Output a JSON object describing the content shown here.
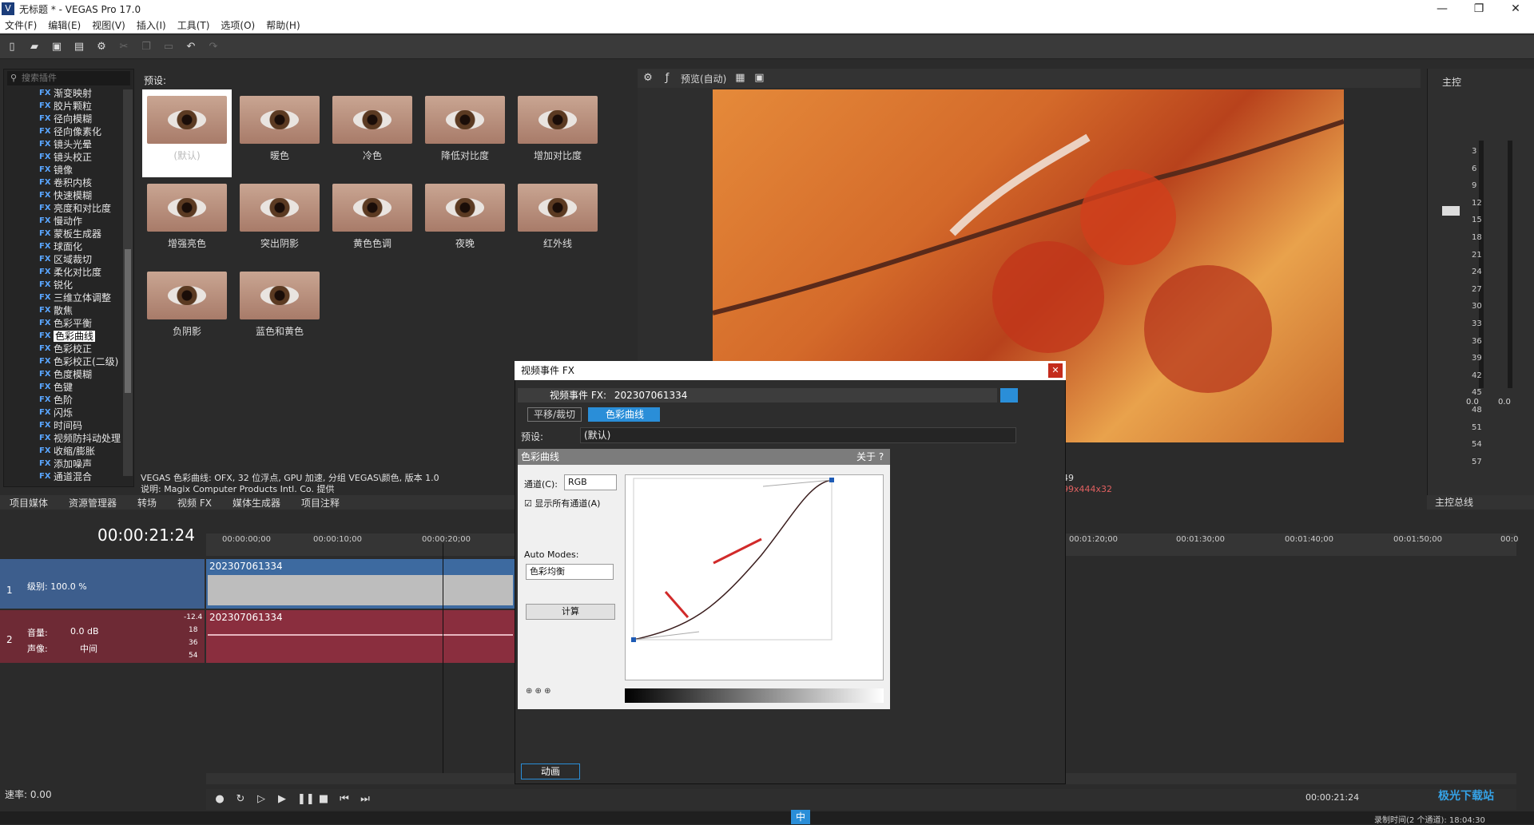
{
  "window": {
    "title": "无标题 * - VEGAS Pro 17.0",
    "minimize": "—",
    "maximize": "❐",
    "close": "✕"
  },
  "menu": [
    "文件(F)",
    "编辑(E)",
    "视图(V)",
    "插入(I)",
    "工具(T)",
    "选项(O)",
    "帮助(H)"
  ],
  "fx_panel": {
    "search_placeholder": "搜索插件",
    "items": [
      "渐变映射",
      "胶片颗粒",
      "径向模糊",
      "径向像素化",
      "镜头光晕",
      "镜头校正",
      "镜像",
      "卷积内核",
      "快速模糊",
      "亮度和对比度",
      "慢动作",
      "蒙板生成器",
      "球面化",
      "区域裁切",
      "柔化对比度",
      "锐化",
      "三维立体调整",
      "散焦",
      "色彩平衡",
      "色彩曲线",
      "色彩校正",
      "色彩校正(二级)",
      "色度模糊",
      "色键",
      "色阶",
      "闪烁",
      "时间码",
      "视频防抖动处理",
      "收缩/膨胀",
      "添加噪声",
      "通道混合"
    ],
    "selected": "色彩曲线",
    "fx_tag": "FX"
  },
  "presets": {
    "label": "预设:",
    "tiles": [
      "(默认)",
      "暖色",
      "冷色",
      "降低对比度",
      "增加对比度",
      "增强亮色",
      "突出阴影",
      "黄色色调",
      "夜晚",
      "红外线",
      "负阴影",
      "蓝色和黄色"
    ],
    "selected": "(默认)"
  },
  "fx_description": {
    "line1": "VEGAS 色彩曲线: OFX, 32 位浮点, GPU 加速, 分组 VEGAS\\颜色, 版本 1.0",
    "line2": "说明: Magix Computer Products Intl. Co. 提供"
  },
  "bottom_tabs": [
    "项目媒体",
    "资源管理器",
    "转场",
    "视频 FX",
    "媒体生成器",
    "项目注释"
  ],
  "preview": {
    "mode": "预览(自动)",
    "info_line1": "49",
    "info_line2": "99x444x32"
  },
  "mixer": {
    "label": "主控",
    "ticks": [
      "3",
      "6",
      "9",
      "12",
      "15",
      "18",
      "21",
      "24",
      "27",
      "30",
      "33",
      "36",
      "39",
      "42",
      "45",
      "48",
      "51",
      "54",
      "57"
    ],
    "bottom_values": [
      "0.0",
      "0.0"
    ],
    "tab": "主控总线"
  },
  "timeline": {
    "timecode": "00:00:21:24",
    "ruler": [
      "00:00:00;00",
      "00:00:10;00",
      "00:00:20;00",
      "00:01:20;00",
      "00:01:30;00",
      "00:01:40;00",
      "00:01:50;00",
      "00:0"
    ],
    "video_track": {
      "num": "1",
      "level": "级别: 100.0 %",
      "clip": "202307061334"
    },
    "audio_track": {
      "num": "2",
      "volume_lbl": "音量:",
      "volume": "0.0 dB",
      "pan_lbl": "声像:",
      "pan": "中间",
      "clip": "202307061334",
      "db_marks": [
        "-12.4",
        "18",
        "36",
        "54"
      ]
    },
    "rate": "速率: 0.00",
    "end_time": "00:00:21:24",
    "record_info": "录制时间(2 个通道): 18:04:30"
  },
  "dialog": {
    "title": "视频事件 FX",
    "chain_label": "视频事件 FX:",
    "chain_name": "202307061334",
    "plugin_pan": "平移/裁切",
    "plugin_curves": "色彩曲线",
    "preset_lbl": "预设:",
    "preset_value": "(默认)",
    "panel_title": "色彩曲线",
    "about": "关于 ?",
    "channel_lbl": "通道(C):",
    "channel_value": "RGB",
    "show_all": "显示所有通道(A)",
    "auto_modes_lbl": "Auto Modes:",
    "auto_modes_value": "色彩均衡",
    "calc_button": "计算",
    "anim_button": "动画"
  },
  "ime": {
    "label": "中"
  },
  "watermark": "极光下载站",
  "colors": {
    "accent": "#2a8ed8",
    "video_track": "#3d5e8d",
    "audio_track": "#6e2a35",
    "close": "#c42b1c"
  }
}
